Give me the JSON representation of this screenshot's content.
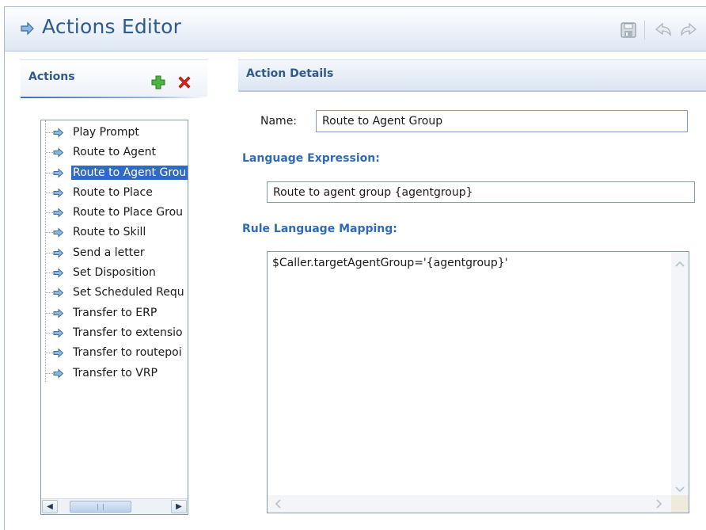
{
  "header": {
    "title": "Actions Editor",
    "icons": {
      "title_icon": "arrow-right-icon",
      "save": "save-icon",
      "undo": "undo-icon",
      "redo": "redo-icon"
    }
  },
  "actions_panel": {
    "title": "Actions",
    "add_icon": "plus-icon",
    "delete_icon": "delete-x-icon",
    "items": [
      {
        "label": "Play Prompt"
      },
      {
        "label": "Route to Agent"
      },
      {
        "label": "Route to Agent Grou",
        "selected": true
      },
      {
        "label": "Route to Place"
      },
      {
        "label": "Route to Place Grou"
      },
      {
        "label": "Route to Skill"
      },
      {
        "label": "Send a letter"
      },
      {
        "label": "Set Disposition"
      },
      {
        "label": "Set Scheduled Requ"
      },
      {
        "label": "Transfer to ERP"
      },
      {
        "label": "Transfer to extensio"
      },
      {
        "label": "Transfer to routepoi"
      },
      {
        "label": "Transfer to VRP"
      }
    ]
  },
  "details_panel": {
    "title": "Action Details",
    "name_label": "Name:",
    "name_value": "Route to Agent Group",
    "language_expression_label": "Language Expression:",
    "language_expression_value": "Route to agent group {agentgroup}",
    "rule_mapping_label": "Rule Language Mapping:",
    "rule_mapping_value": "$Caller.targetAgentGroup='{agentgroup}'"
  },
  "colors": {
    "title_blue": "#2e5a8c",
    "section_blue": "#2e6bb4",
    "selection": "#316ac5",
    "arrow_fill": "#8fb6de",
    "delete_red": "#d9261c",
    "add_green": "#3aa832"
  }
}
